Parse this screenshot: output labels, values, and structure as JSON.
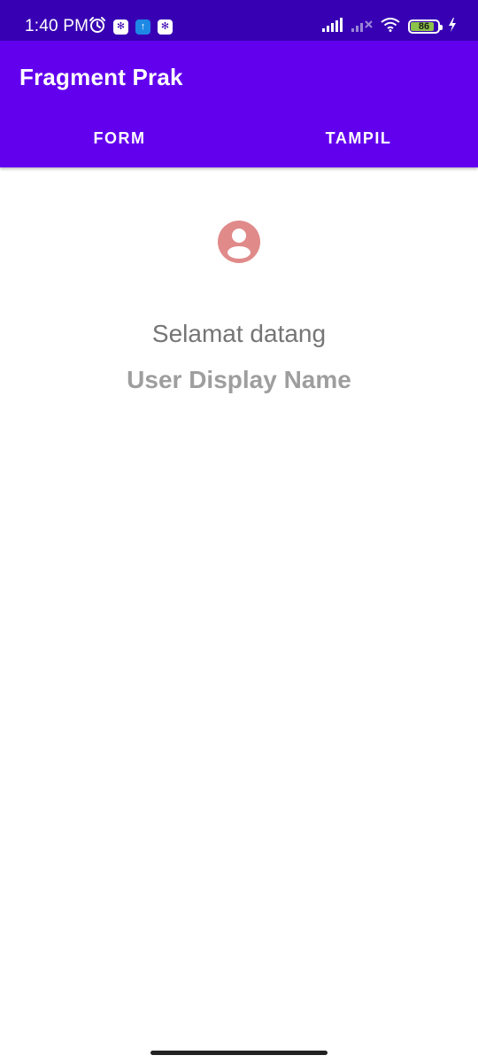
{
  "status_bar": {
    "time": "1:40 PM",
    "battery_level": "86",
    "icons_left": [
      "alarm-icon",
      "notification-app-icon",
      "upload-icon",
      "notification-app-icon"
    ],
    "icons_right": [
      "signal-icon",
      "signal-off-icon",
      "wifi-icon",
      "battery-icon",
      "charging-icon"
    ]
  },
  "app_bar": {
    "title": "Fragment Prak"
  },
  "tabs": [
    {
      "label": "FORM"
    },
    {
      "label": "TAMPIL"
    }
  ],
  "content": {
    "avatar_icon": "account-circle-icon",
    "welcome_text": "Selamat datang",
    "display_name": "User Display Name"
  },
  "colors": {
    "status_bar": "#3700b3",
    "primary": "#6200ee",
    "avatar": "#e08a8a",
    "welcome_text": "#757575",
    "name_text": "#9e9e9e"
  }
}
